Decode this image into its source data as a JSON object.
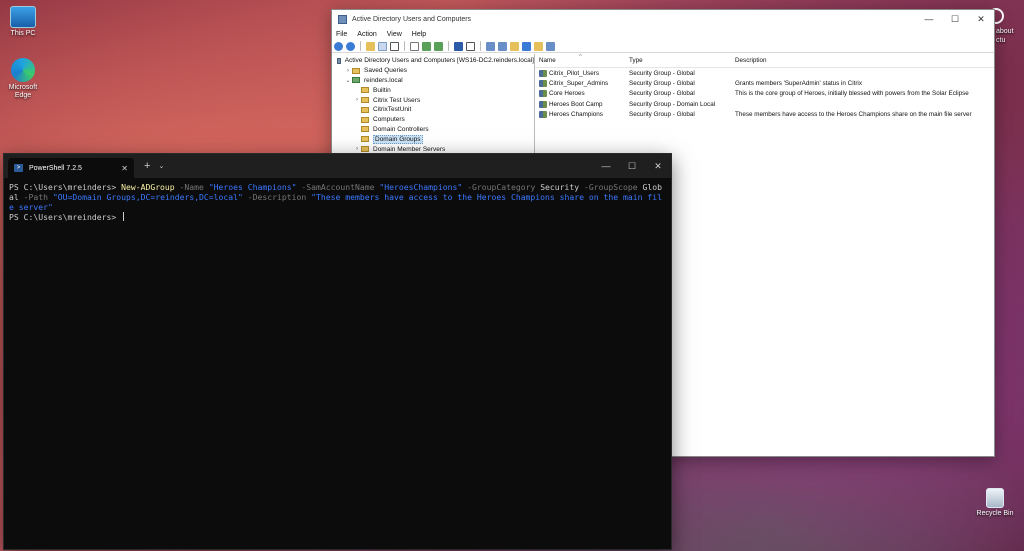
{
  "desktop": {
    "icons": [
      {
        "label": "This PC"
      },
      {
        "label": "Microsoft Edge"
      },
      {
        "label": "Recycle Bin"
      }
    ],
    "right_partial_text": "about\nctu"
  },
  "ad_window": {
    "title": "Active Directory Users and Computers",
    "menu": [
      "File",
      "Action",
      "View",
      "Help"
    ],
    "tree": [
      {
        "label": "Active Directory Users and Computers [WS16-DC2.reinders.local]",
        "level": 0,
        "twisty": "",
        "icon": "root"
      },
      {
        "label": "Saved Queries",
        "level": 1,
        "twisty": "›",
        "icon": "folder"
      },
      {
        "label": "reinders.local",
        "level": 1,
        "twisty": "⌄",
        "icon": "domain"
      },
      {
        "label": "Builtin",
        "level": 2,
        "twisty": "",
        "icon": "folder"
      },
      {
        "label": "Citrix Test Users",
        "level": 2,
        "twisty": "›",
        "icon": "folder"
      },
      {
        "label": "CitrixTestUnit",
        "level": 2,
        "twisty": "",
        "icon": "folder"
      },
      {
        "label": "Computers",
        "level": 2,
        "twisty": "",
        "icon": "folder"
      },
      {
        "label": "Domain Controllers",
        "level": 2,
        "twisty": "",
        "icon": "folder"
      },
      {
        "label": "Domain Groups",
        "level": 2,
        "twisty": "",
        "icon": "folder",
        "selected": true
      },
      {
        "label": "Domain Member Servers",
        "level": 2,
        "twisty": "›",
        "icon": "folder"
      }
    ],
    "columns": [
      "Name",
      "Type",
      "Description"
    ],
    "rows": [
      {
        "name": "Citrix_Pilot_Users",
        "type": "Security Group - Global",
        "description": ""
      },
      {
        "name": "Citrix_Super_Admins",
        "type": "Security Group - Global",
        "description": "Grants members 'SuperAdmin' status in Citrix"
      },
      {
        "name": "Core Heroes",
        "type": "Security Group - Global",
        "description": "This is the core group of Heroes, initially blessed with powers from the Solar Eclipse"
      },
      {
        "name": "Heroes Boot Camp",
        "type": "Security Group - Domain Local",
        "description": ""
      },
      {
        "name": "Heroes Champions",
        "type": "Security Group - Global",
        "description": "These members have access to the Heroes Champions share on the main file server"
      }
    ]
  },
  "powershell": {
    "tab_title": "PowerShell 7.2.5",
    "prompt": "PS C:\\Users\\mreinders>",
    "command": {
      "cmdlet": "New-ADGroup",
      "tokens": [
        {
          "k": "par",
          "t": " -Name "
        },
        {
          "k": "str",
          "t": "\"Heroes Champions\""
        },
        {
          "k": "par",
          "t": " -SamAccountName "
        },
        {
          "k": "str",
          "t": "\"HeroesChampions\""
        },
        {
          "k": "par",
          "t": " -GroupCategory "
        },
        {
          "k": "arg",
          "t": "Security"
        },
        {
          "k": "par",
          "t": " -GroupScope "
        },
        {
          "k": "arg",
          "t": "Global"
        },
        {
          "k": "par",
          "t": " -Path "
        },
        {
          "k": "str",
          "t": "\"OU=Domain Groups,DC=reinders,DC=local\""
        },
        {
          "k": "par",
          "t": " -Description "
        },
        {
          "k": "str",
          "t": "\"These members have access to the Heroes Champions share on the main file server\""
        }
      ]
    }
  }
}
